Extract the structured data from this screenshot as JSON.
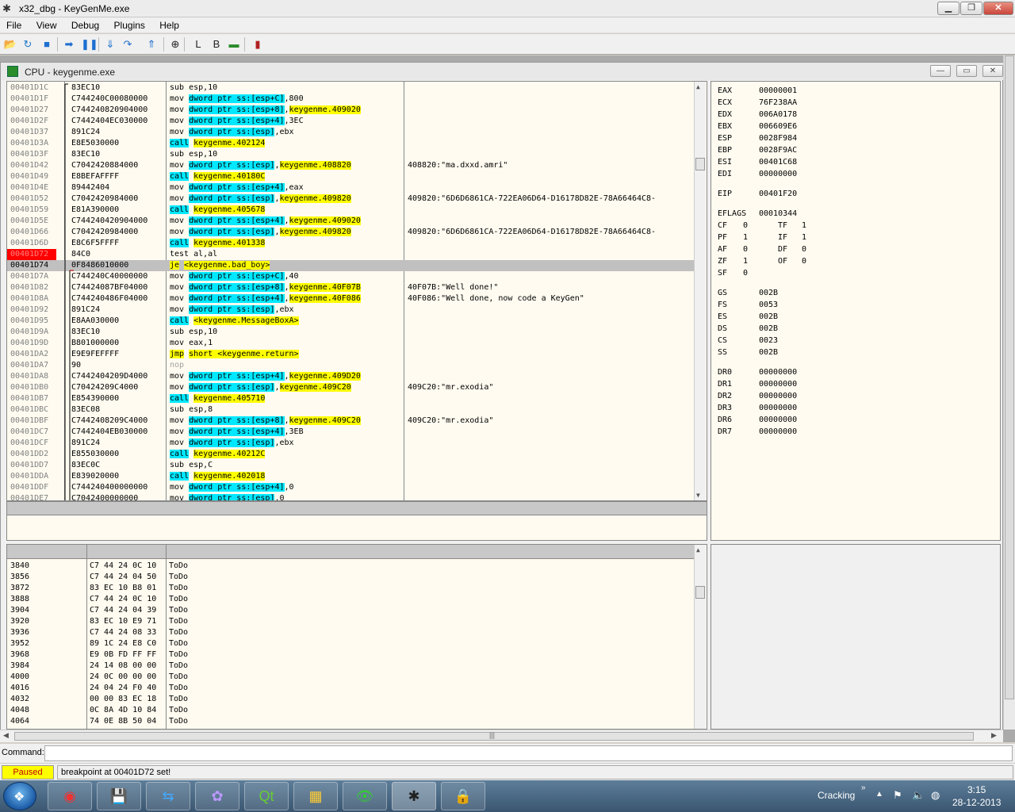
{
  "window": {
    "title": "x32_dbg - KeyGenMe.exe",
    "min": "▁",
    "max": "❐",
    "close": "✕"
  },
  "menu": [
    "File",
    "View",
    "Debug",
    "Plugins",
    "Help"
  ],
  "toolbar": [
    {
      "name": "open-icon",
      "glyph": "📂",
      "color": "#c89a1a"
    },
    {
      "name": "restart-icon",
      "glyph": "↻",
      "color": "#1e78c8"
    },
    {
      "name": "stop-icon",
      "glyph": "■",
      "color": "#1e6fd0"
    },
    {
      "name": "run-icon",
      "glyph": "➡",
      "color": "#1e6fd0"
    },
    {
      "name": "pause-icon",
      "glyph": "❚❚",
      "color": "#1e6fd0"
    },
    {
      "name": "step-into-icon",
      "glyph": "⇓",
      "color": "#1e6fd0"
    },
    {
      "name": "step-over-icon",
      "glyph": "↷",
      "color": "#1e6fd0"
    },
    {
      "name": "execute-till-return-icon",
      "glyph": "⇑",
      "color": "#1e6fd0"
    },
    {
      "name": "target-icon",
      "glyph": "⊕",
      "color": "#222"
    },
    {
      "name": "log-icon",
      "glyph": "L",
      "color": "#222"
    },
    {
      "name": "breakpoints-icon",
      "glyph": "B",
      "color": "#222"
    },
    {
      "name": "memory-map-icon",
      "glyph": "▬",
      "color": "#2a8c2a"
    },
    {
      "name": "scylla-icon",
      "glyph": "▮",
      "color": "#b02020"
    }
  ],
  "cpu": {
    "title": "CPU - keygenme.exe",
    "min": "—",
    "max": "▭",
    "close": "✕"
  },
  "disasm": [
    {
      "a": "00401D1C",
      "b": "83EC10",
      "i": [
        [
          "sub esp,10",
          ""
        ]
      ],
      "c": ""
    },
    {
      "a": "00401D1F",
      "b": "C744240C00080000",
      "i": [
        [
          "mov ",
          ""
        ],
        [
          "dword ptr ss:[esp+C]",
          "c"
        ],
        [
          ",800",
          ""
        ]
      ],
      "c": ""
    },
    {
      "a": "00401D27",
      "b": "C744240820904000",
      "i": [
        [
          "mov ",
          ""
        ],
        [
          "dword ptr ss:[esp+8]",
          "c"
        ],
        [
          ",",
          ""
        ],
        [
          "keygenme.409020",
          "y"
        ]
      ],
      "c": ""
    },
    {
      "a": "00401D2F",
      "b": "C7442404EC030000",
      "i": [
        [
          "mov ",
          ""
        ],
        [
          "dword ptr ss:[esp+4]",
          "c"
        ],
        [
          ",3EC",
          ""
        ]
      ],
      "c": ""
    },
    {
      "a": "00401D37",
      "b": "891C24",
      "i": [
        [
          "mov ",
          ""
        ],
        [
          "dword ptr ss:[esp]",
          "c"
        ],
        [
          ",ebx",
          ""
        ]
      ],
      "c": ""
    },
    {
      "a": "00401D3A",
      "b": "E8E5030000",
      "i": [
        [
          "call",
          "c"
        ],
        [
          " ",
          ""
        ],
        [
          "keygenme.402124",
          "y"
        ]
      ],
      "c": ""
    },
    {
      "a": "00401D3F",
      "b": "83EC10",
      "i": [
        [
          "sub esp,10",
          ""
        ]
      ],
      "c": ""
    },
    {
      "a": "00401D42",
      "b": "C7042420884000",
      "i": [
        [
          "mov ",
          ""
        ],
        [
          "dword ptr ss:[esp]",
          "c"
        ],
        [
          ",",
          ""
        ],
        [
          "keygenme.408820",
          "y"
        ]
      ],
      "c": "408820:\"ma.dxxd.amri\""
    },
    {
      "a": "00401D49",
      "b": "E8BEFAFFFF",
      "i": [
        [
          "call",
          "c"
        ],
        [
          " ",
          ""
        ],
        [
          "keygenme.40180C",
          "y"
        ]
      ],
      "c": ""
    },
    {
      "a": "00401D4E",
      "b": "89442404",
      "i": [
        [
          "mov ",
          ""
        ],
        [
          "dword ptr ss:[esp+4]",
          "c"
        ],
        [
          ",eax",
          ""
        ]
      ],
      "c": ""
    },
    {
      "a": "00401D52",
      "b": "C7042420984000",
      "i": [
        [
          "mov ",
          ""
        ],
        [
          "dword ptr ss:[esp]",
          "c"
        ],
        [
          ",",
          ""
        ],
        [
          "keygenme.409820",
          "y"
        ]
      ],
      "c": "409820:\"6D6D6861CA-722EA06D64-D16178D82E-78A66464C8-"
    },
    {
      "a": "00401D59",
      "b": "E81A390000",
      "i": [
        [
          "call",
          "c"
        ],
        [
          " ",
          ""
        ],
        [
          "keygenme.405678",
          "y"
        ]
      ],
      "c": ""
    },
    {
      "a": "00401D5E",
      "b": "C744240420904000",
      "i": [
        [
          "mov ",
          ""
        ],
        [
          "dword ptr ss:[esp+4]",
          "c"
        ],
        [
          ",",
          ""
        ],
        [
          "keygenme.409020",
          "y"
        ]
      ],
      "c": ""
    },
    {
      "a": "00401D66",
      "b": "C7042420984000",
      "i": [
        [
          "mov ",
          ""
        ],
        [
          "dword ptr ss:[esp]",
          "c"
        ],
        [
          ",",
          ""
        ],
        [
          "keygenme.409820",
          "y"
        ]
      ],
      "c": "409820:\"6D6D6861CA-722EA06D64-D16178D82E-78A66464C8-"
    },
    {
      "a": "00401D6D",
      "b": "E8C6F5FFFF",
      "i": [
        [
          "call",
          "c"
        ],
        [
          " ",
          ""
        ],
        [
          "keygenme.401338",
          "y"
        ]
      ],
      "c": ""
    },
    {
      "a": "00401D72",
      "b": "84C0",
      "i": [
        [
          "test al,al",
          ""
        ]
      ],
      "c": "",
      "bp": true
    },
    {
      "a": "00401D74",
      "b": "0F8486010000",
      "i": [
        [
          "je",
          "y"
        ],
        [
          " ",
          ""
        ],
        [
          "<keygenme.bad_boy>",
          "y"
        ]
      ],
      "c": "",
      "sel": true
    },
    {
      "a": "00401D7A",
      "b": "C744240C40000000",
      "i": [
        [
          "mov ",
          ""
        ],
        [
          "dword ptr ss:[esp+C]",
          "c"
        ],
        [
          ",40",
          ""
        ]
      ],
      "c": ""
    },
    {
      "a": "00401D82",
      "b": "C74424087BF04000",
      "i": [
        [
          "mov ",
          ""
        ],
        [
          "dword ptr ss:[esp+8]",
          "c"
        ],
        [
          ",",
          ""
        ],
        [
          "keygenme.40F07B",
          "y"
        ]
      ],
      "c": "40F07B:\"Well done!\""
    },
    {
      "a": "00401D8A",
      "b": "C744240486F04000",
      "i": [
        [
          "mov ",
          ""
        ],
        [
          "dword ptr ss:[esp+4]",
          "c"
        ],
        [
          ",",
          ""
        ],
        [
          "keygenme.40F086",
          "y"
        ]
      ],
      "c": "40F086:\"Well done, now code a KeyGen\""
    },
    {
      "a": "00401D92",
      "b": "891C24",
      "i": [
        [
          "mov ",
          ""
        ],
        [
          "dword ptr ss:[esp]",
          "c"
        ],
        [
          ",ebx",
          ""
        ]
      ],
      "c": ""
    },
    {
      "a": "00401D95",
      "b": "E8AA030000",
      "i": [
        [
          "call",
          "c"
        ],
        [
          " ",
          ""
        ],
        [
          "<keygenme.MessageBoxA>",
          "y"
        ]
      ],
      "c": ""
    },
    {
      "a": "00401D9A",
      "b": "83EC10",
      "i": [
        [
          "sub esp,10",
          ""
        ]
      ],
      "c": ""
    },
    {
      "a": "00401D9D",
      "b": "B801000000",
      "i": [
        [
          "mov eax,1",
          ""
        ]
      ],
      "c": ""
    },
    {
      "a": "00401DA2",
      "b": "E9E9FEFFFF",
      "i": [
        [
          "jmp",
          "y"
        ],
        [
          " ",
          ""
        ],
        [
          "short <keygenme.return>",
          "y"
        ]
      ],
      "c": ""
    },
    {
      "a": "00401DA7",
      "b": "90",
      "i": [
        [
          "nop",
          "g"
        ]
      ],
      "c": ""
    },
    {
      "a": "00401DA8",
      "b": "C7442404209D4000",
      "i": [
        [
          "mov ",
          ""
        ],
        [
          "dword ptr ss:[esp+4]",
          "c"
        ],
        [
          ",",
          ""
        ],
        [
          "keygenme.409D20",
          "y"
        ]
      ],
      "c": ""
    },
    {
      "a": "00401DB0",
      "b": "C70424209C4000",
      "i": [
        [
          "mov ",
          ""
        ],
        [
          "dword ptr ss:[esp]",
          "c"
        ],
        [
          ",",
          ""
        ],
        [
          "keygenme.409C20",
          "y"
        ]
      ],
      "c": "409C20:\"mr.exodia\""
    },
    {
      "a": "00401DB7",
      "b": "E854390000",
      "i": [
        [
          "call",
          "c"
        ],
        [
          " ",
          ""
        ],
        [
          "keygenme.405710",
          "y"
        ]
      ],
      "c": ""
    },
    {
      "a": "00401DBC",
      "b": "83EC08",
      "i": [
        [
          "sub esp,8",
          ""
        ]
      ],
      "c": ""
    },
    {
      "a": "00401DBF",
      "b": "C7442408209C4000",
      "i": [
        [
          "mov ",
          ""
        ],
        [
          "dword ptr ss:[esp+8]",
          "c"
        ],
        [
          ",",
          ""
        ],
        [
          "keygenme.409C20",
          "y"
        ]
      ],
      "c": "409C20:\"mr.exodia\""
    },
    {
      "a": "00401DC7",
      "b": "C7442404EB030000",
      "i": [
        [
          "mov ",
          ""
        ],
        [
          "dword ptr ss:[esp+4]",
          "c"
        ],
        [
          ",3EB",
          ""
        ]
      ],
      "c": ""
    },
    {
      "a": "00401DCF",
      "b": "891C24",
      "i": [
        [
          "mov ",
          ""
        ],
        [
          "dword ptr ss:[esp]",
          "c"
        ],
        [
          ",ebx",
          ""
        ]
      ],
      "c": ""
    },
    {
      "a": "00401DD2",
      "b": "E855030000",
      "i": [
        [
          "call",
          "c"
        ],
        [
          " ",
          ""
        ],
        [
          "keygenme.40212C",
          "y"
        ]
      ],
      "c": ""
    },
    {
      "a": "00401DD7",
      "b": "83EC0C",
      "i": [
        [
          "sub esp,C",
          ""
        ]
      ],
      "c": ""
    },
    {
      "a": "00401DDA",
      "b": "E839020000",
      "i": [
        [
          "call",
          "c"
        ],
        [
          " ",
          ""
        ],
        [
          "keygenme.402018",
          "y"
        ]
      ],
      "c": ""
    },
    {
      "a": "00401DDF",
      "b": "C744240400000000",
      "i": [
        [
          "mov ",
          ""
        ],
        [
          "dword ptr ss:[esp+4]",
          "c"
        ],
        [
          ",0",
          ""
        ]
      ],
      "c": ""
    },
    {
      "a": "00401DE7",
      "b": "C7042400000000",
      "i": [
        [
          "mov ",
          ""
        ],
        [
          "dword ptr ss:[esp]",
          "c"
        ],
        [
          ",0",
          ""
        ]
      ],
      "c": ""
    }
  ],
  "registers": {
    "gp": [
      [
        "EAX",
        "00000001"
      ],
      [
        "ECX",
        "76F238AA"
      ],
      [
        "EDX",
        "006A0178"
      ],
      [
        "EBX",
        "006609E6"
      ],
      [
        "ESP",
        "0028F984"
      ],
      [
        "EBP",
        "0028F9AC"
      ],
      [
        "ESI",
        "00401C68"
      ],
      [
        "EDI",
        "00000000"
      ]
    ],
    "eip": [
      "EIP",
      "00401F20"
    ],
    "eflags": [
      "EFLAGS",
      "00010344"
    ],
    "flags": [
      [
        "CF",
        "0",
        "TF",
        "1"
      ],
      [
        "PF",
        "1",
        "IF",
        "1"
      ],
      [
        "AF",
        "0",
        "DF",
        "0"
      ],
      [
        "ZF",
        "1",
        "OF",
        "0"
      ],
      [
        "SF",
        "0",
        "",
        ""
      ]
    ],
    "seg": [
      [
        "GS",
        "002B"
      ],
      [
        "FS",
        "0053"
      ],
      [
        "ES",
        "002B"
      ],
      [
        "DS",
        "002B"
      ],
      [
        "CS",
        "0023"
      ],
      [
        "SS",
        "002B"
      ]
    ],
    "dr": [
      [
        "DR0",
        "00000000"
      ],
      [
        "DR1",
        "00000000"
      ],
      [
        "DR2",
        "00000000"
      ],
      [
        "DR3",
        "00000000"
      ],
      [
        "DR6",
        "00000000"
      ],
      [
        "DR7",
        "00000000"
      ]
    ]
  },
  "dump": [
    [
      "3840",
      "C7 44 24 0C 10",
      "ToDo"
    ],
    [
      "3856",
      "C7 44 24 04 50",
      "ToDo"
    ],
    [
      "3872",
      "83 EC 10 B8 01",
      "ToDo"
    ],
    [
      "3888",
      "C7 44 24 0C 10",
      "ToDo"
    ],
    [
      "3904",
      "C7 44 24 04 39",
      "ToDo"
    ],
    [
      "3920",
      "83 EC 10 E9 71",
      "ToDo"
    ],
    [
      "3936",
      "C7 44 24 08 33",
      "ToDo"
    ],
    [
      "3952",
      "89 1C 24 E8 C0",
      "ToDo"
    ],
    [
      "3968",
      "E9 0B FD FF FF",
      "ToDo"
    ],
    [
      "3984",
      "24 14 08 00 00",
      "ToDo"
    ],
    [
      "4000",
      "24 0C 00 00 00",
      "ToDo"
    ],
    [
      "4016",
      "24 04 24 F0 40",
      "ToDo"
    ],
    [
      "4032",
      "00 00 83 EC 18",
      "ToDo"
    ],
    [
      "4048",
      "0C 8A 4D 10 84",
      "ToDo"
    ],
    [
      "4064",
      "74 0E 8B 50 04",
      "ToDo"
    ]
  ],
  "command": {
    "label": "Command:",
    "value": ""
  },
  "status": {
    "state": "Paused",
    "message": "breakpoint at 00401D72 set!"
  },
  "taskbar": {
    "apps": [
      {
        "name": "chrome-icon",
        "glyph": "◉",
        "color": "#e33"
      },
      {
        "name": "floppy-save-icon",
        "glyph": "💾",
        "color": "#fff"
      },
      {
        "name": "teamviewer-icon",
        "glyph": "⇆",
        "color": "#4af"
      },
      {
        "name": "pidgin-icon",
        "glyph": "✿",
        "color": "#b9f"
      },
      {
        "name": "qt-icon",
        "glyph": "Qt",
        "color": "#6c3"
      },
      {
        "name": "windows-flag-icon",
        "glyph": "▦",
        "color": "#fc3"
      },
      {
        "name": "eye-icon",
        "glyph": "👁",
        "color": "#3c3"
      },
      {
        "name": "bug-icon",
        "glyph": "✱",
        "color": "#222"
      },
      {
        "name": "lock-icon",
        "glyph": "🔒",
        "color": "#fc6"
      }
    ],
    "tray_label": "Cracking",
    "time": "3:15",
    "date": "28-12-2013"
  }
}
